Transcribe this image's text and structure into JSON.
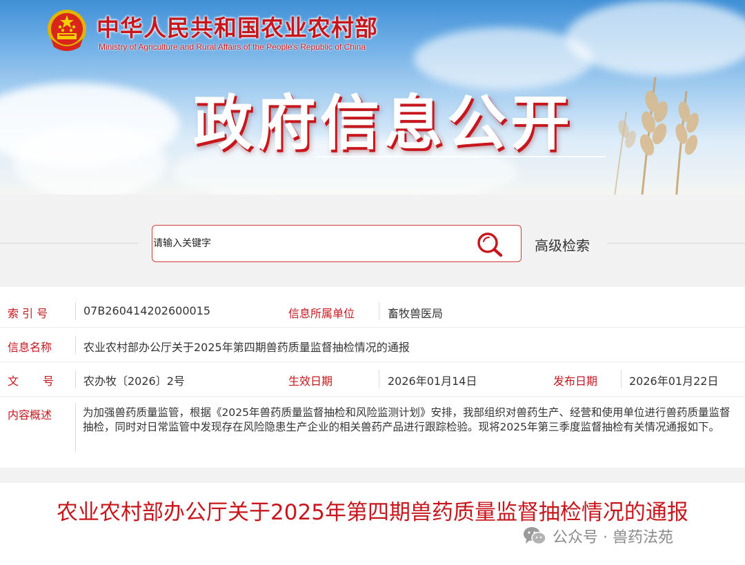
{
  "header": {
    "ministry_cn": "中华人民共和国农业农村部",
    "ministry_en": "Ministry of Agriculture and Rural Affairs of the People's Republic of China",
    "banner_title": "政府信息公开"
  },
  "search": {
    "placeholder": "请输入关键字",
    "advanced_label": "高级检索"
  },
  "info": {
    "index_label": "索 引 号",
    "index_value": "07B260414202600015",
    "unit_label": "信息所属单位",
    "unit_value": "畜牧兽医局",
    "name_label": "信息名称",
    "name_value": "农业农村部办公厅关于2025年第四期兽药质量监督抽检情况的通报",
    "doc_label_1": "文",
    "doc_label_2": "号",
    "doc_value": "农办牧〔2026〕2号",
    "effective_label": "生效日期",
    "effective_value": "2026年01月14日",
    "publish_label": "发布日期",
    "publish_value": "2026年01月22日",
    "summary_label": "内容概述",
    "summary_value": "为加强兽药质量监管，根据《2025年兽药质量监督抽检和风险监测计划》安排，我部组织对兽药生产、经营和使用单位进行兽药质量监督抽检，同时对日常监管中发现存在风险隐患生产企业的相关兽药产品进行跟踪检验。现将2025年第三季度监督抽检有关情况通报如下。"
  },
  "article": {
    "title": "农业农村部办公厅关于2025年第四期兽药质量监督抽检情况的通报"
  },
  "watermark": {
    "text": "公众号 · 兽药法苑",
    "icon": "wechat-icon"
  },
  "colors": {
    "accent_red": "#c8161d",
    "search_border": "#d13a3a",
    "sky_blue": "#5fa4e2"
  },
  "icons": {
    "emblem": "national-emblem-icon",
    "search": "search-icon"
  }
}
